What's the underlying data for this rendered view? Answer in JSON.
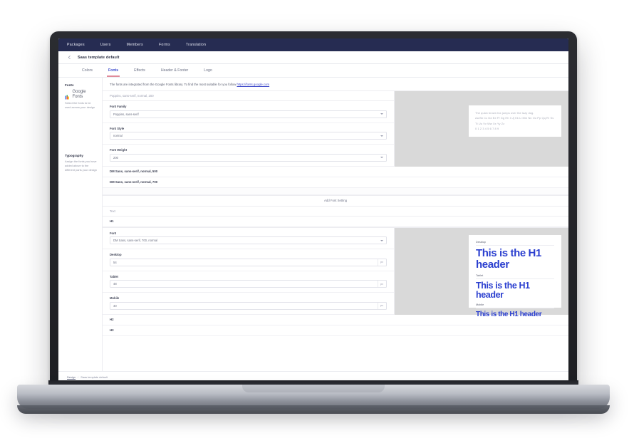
{
  "topnav": {
    "items": [
      {
        "label": "Packages"
      },
      {
        "label": "Users"
      },
      {
        "label": "Members"
      },
      {
        "label": "Forms"
      },
      {
        "label": "Translation"
      }
    ]
  },
  "breadcrumb_bar": {
    "back_icon": "arrow-left-icon",
    "title": "Saas template default"
  },
  "tabs": [
    {
      "label": "Colors",
      "active": false
    },
    {
      "label": "Fonts",
      "active": true
    },
    {
      "label": "Effects",
      "active": false
    },
    {
      "label": "Header & Footer",
      "active": false
    },
    {
      "label": "Logo",
      "active": false
    }
  ],
  "fonts_section": {
    "rail_title": "Fonts",
    "logo_text": "Google Fonts",
    "logo_icon": "google-fonts-icon",
    "rail_desc": "Select the fonts to be used across your design",
    "description": "The fonts are integrated from the Google Fonts library. To find the most suitable for you follow ",
    "link_text": "https://fonts.google.com",
    "current_row": "Poppins, sans-serif, normal, 200",
    "fields": [
      {
        "label": "Font Family",
        "value": "Poppins, sans-serif",
        "icon": "chevron-down-icon"
      },
      {
        "label": "Font Style",
        "value": "normal",
        "icon": "chevron-down-icon"
      },
      {
        "label": "Font Weight",
        "value": "200",
        "icon": "chevron-down-icon"
      }
    ],
    "saved_fonts": [
      "DM Sans, sans-serif, normal, 500",
      "DM Sans, sans-serif, normal, 700"
    ],
    "add_button": "Add Font Setting",
    "preview": {
      "sentence": "The quick brown fox jumps over the lazy dog.",
      "alphabet": "Aa Bb Cc Dd Ee Ff Gg Hh Ii Jj Kk Ll Mm Nn Oo Pp Qq Rr Ss Tt Uu Vv Ww Xx Yy Zz",
      "numbers": "0 1 2 3 4 5 6 7 8 9"
    }
  },
  "typography_section": {
    "rail_title": "Typography",
    "rail_desc": "Assign the fonts you have added above to the different parts your design",
    "rows": [
      {
        "label": "Text"
      },
      {
        "label": "H1"
      }
    ],
    "font_field": {
      "label": "Font",
      "value": "DM Sans, sans-serif, 700, normal",
      "icon": "chevron-down-icon"
    },
    "sizes": [
      {
        "label": "Desktop",
        "value": "54",
        "unit": "px"
      },
      {
        "label": "Tablet",
        "value": "48",
        "unit": "px"
      },
      {
        "label": "Mobile",
        "value": "40",
        "unit": "px"
      }
    ],
    "preview_blocks": [
      {
        "label": "Desktop",
        "text": "This is the H1 header",
        "size": "h1-d"
      },
      {
        "label": "Tablet",
        "text": "This is the H1 header",
        "size": "h1-t"
      },
      {
        "label": "Mobile",
        "text": "This is the H1 header",
        "size": "h1-m"
      }
    ],
    "bottom_rows": [
      {
        "label": "H2"
      },
      {
        "label": "H3"
      }
    ]
  },
  "footer": {
    "root": "Design",
    "separator": "/",
    "current": "Saas template default"
  },
  "colors": {
    "navbar": "#262c52",
    "accent_blue": "#2b3fcf",
    "tab_active": "#3d4ccd",
    "tab_underline": "#e08a9a",
    "preview_bg": "#d9d9d9",
    "link": "#3f4ac9"
  }
}
